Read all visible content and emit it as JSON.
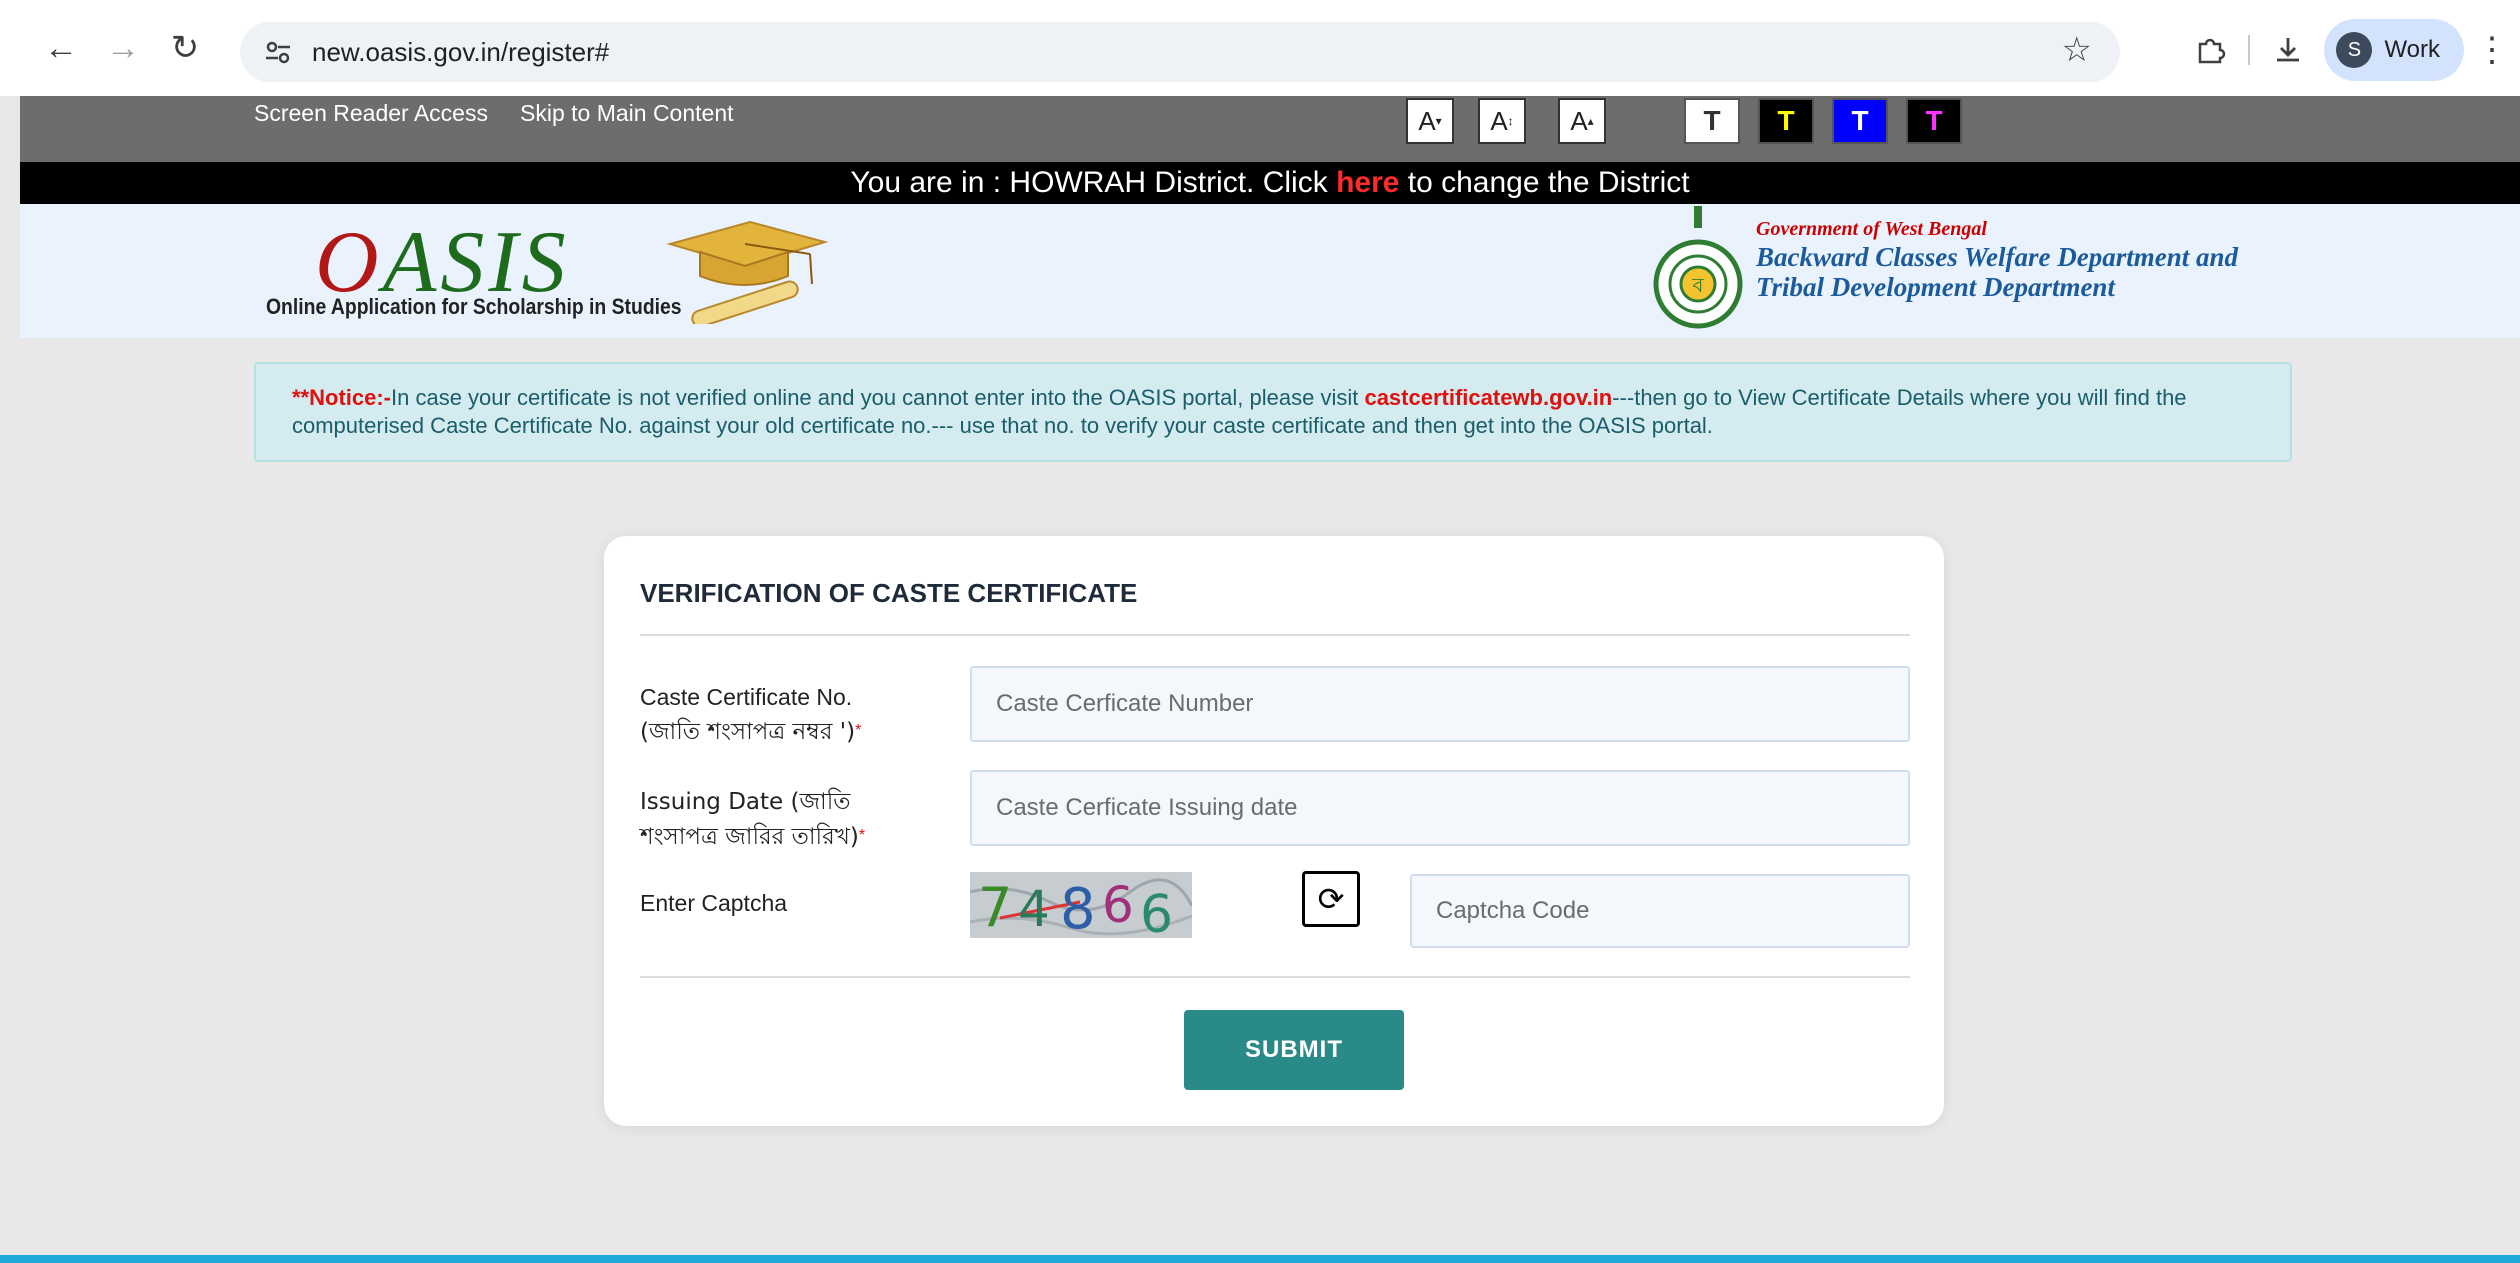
{
  "browser": {
    "url": "new.oasis.gov.in/register#",
    "profile_initial": "S",
    "profile_label": "Work"
  },
  "topbar": {
    "screen_reader": "Screen Reader Access",
    "skip_main": "Skip to Main Content",
    "font_buttons": [
      "A",
      "A",
      "A"
    ],
    "theme_buttons": [
      {
        "label": "T",
        "bg": "#ffffff",
        "fg": "#333333"
      },
      {
        "label": "T",
        "bg": "#000000",
        "fg": "#ffff00"
      },
      {
        "label": "T",
        "bg": "#0000ff",
        "fg": "#ffffff"
      },
      {
        "label": "T",
        "bg": "#000000",
        "fg": "#ff33ff"
      }
    ]
  },
  "district": {
    "prefix": "You are in : HOWRAH District. Click ",
    "link": "here",
    "suffix": " to change the District"
  },
  "header": {
    "logo_o": "O",
    "logo_rest": "ASIS",
    "logo_tagline": "Online Application for Scholarship in Studies",
    "gov_line1": "Government of West Bengal",
    "gov_line2": "Backward Classes Welfare Department and",
    "gov_line3": "Tribal Development Department"
  },
  "notice": {
    "label": "**Notice:-",
    "text1": "In case your certificate is not verified online and you cannot enter into the OASIS portal, please visit ",
    "link": "castcertificatewb.gov.in",
    "text2": "---then go to View Certificate Details where you will find the computerised Caste Certificate No. against your old certificate no.--- use that no. to verify your caste certificate and then get into the OASIS portal."
  },
  "form": {
    "title": "VERIFICATION OF CASTE CERTIFICATE",
    "cert_label_1": "Caste Certificate No.",
    "cert_label_2": "(জাতি শংসাপত্র নম্বর ')",
    "cert_placeholder": "Caste Cerficate Number",
    "date_label_1": "Issuing Date (জাতি",
    "date_label_2": "শংসাপত্র জারির তারিখ)",
    "date_placeholder": "Caste Cerficate Issuing date",
    "captcha_label": "Enter Captcha",
    "captcha_chars": [
      "7",
      "4",
      "8",
      "6",
      "6"
    ],
    "captcha_placeholder": "Captcha Code",
    "required_mark": "*",
    "submit": "SUBMIT"
  }
}
